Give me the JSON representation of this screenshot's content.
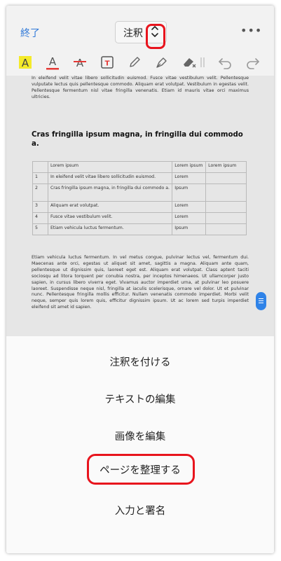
{
  "topbar": {
    "done_label": "終了",
    "mode_value": "注釈",
    "more_label": "•••"
  },
  "toolbar": {
    "items": [
      "highlight-icon",
      "text-color-icon",
      "strikethrough-icon",
      "text-box-icon",
      "pencil-icon",
      "pen-icon",
      "eraser-icon",
      "undo-icon",
      "redo-icon"
    ],
    "highlight_glyph": "A",
    "color_glyph": "A",
    "strike_glyph": "A",
    "textbox_glyph": "T",
    "accent_yellow": "#f4ea2a",
    "accent_red": "#e53935"
  },
  "document": {
    "intro": "In eleifend velit vitae libero sollicitudin euismod. Fusce vitae vestibulum velit. Pellentesque vulputate lectus quis pellentesque commodo. Aliquam erat volutpat. Vestibulum in egestas velit. Pellentesque fermentum nisl vitae fringilla venenatis. Etiam id mauris vitae orci maximus ultricies.",
    "heading": "Cras fringilla ipsum magna, in fringilla dui commodo a.",
    "table": {
      "header": [
        "",
        "Lorem ipsum",
        "Lorem ipsum",
        "Lorem ipsum"
      ],
      "rows": [
        [
          "1",
          "In eleifend velit vitae libero sollicitudin euismod.",
          "Lorem",
          ""
        ],
        [
          "2",
          "Cras fringilla ipsum magna, in fringilla dui commodo a.",
          "Ipsum",
          ""
        ],
        [
          "3",
          "Aliquam erat volutpat.",
          "Lorem",
          ""
        ],
        [
          "4",
          "Fusce vitae vestibulum velit.",
          "Lorem",
          ""
        ],
        [
          "5",
          "Etiam vehicula luctus fermentum.",
          "Ipsum",
          ""
        ]
      ]
    },
    "body": "Etiam vehicula luctus fermentum. In vel metus congue, pulvinar lectus vel, fermentum dui. Maecenas ante orci, egestas ut aliquet sit amet, sagittis a magna. Aliquam ante quam, pellentesque ut dignissim quis, laoreet eget est. Aliquam erat volutpat. Class aptent taciti sociosqu ad litora torquent per conubia nostra, per inceptos himenaeos. Ut ullamcorper justo sapien, in cursus libero viverra eget. Vivamus auctor imperdiet urna, at pulvinar leo posuere laoreet. Suspendisse neque nisl, fringilla at iaculis scelerisque, ornare vel dolor. Ut et pulvinar nunc. Pellentesque fringilla mollis efficitur. Nullam venenatis commodo imperdiet. Morbi velit neque, semper quis lorem quis, efficitur dignissim ipsum. Ut ac lorem sed turpis imperdiet eleifend sit amet id sapien."
  },
  "menu": {
    "items": [
      "注釈を付ける",
      "テキストの編集",
      "画像を編集",
      "ページを整理する",
      "入力と署名"
    ]
  },
  "colors": {
    "accent_blue": "#2f78d8",
    "highlight_red": "#e8141d"
  }
}
